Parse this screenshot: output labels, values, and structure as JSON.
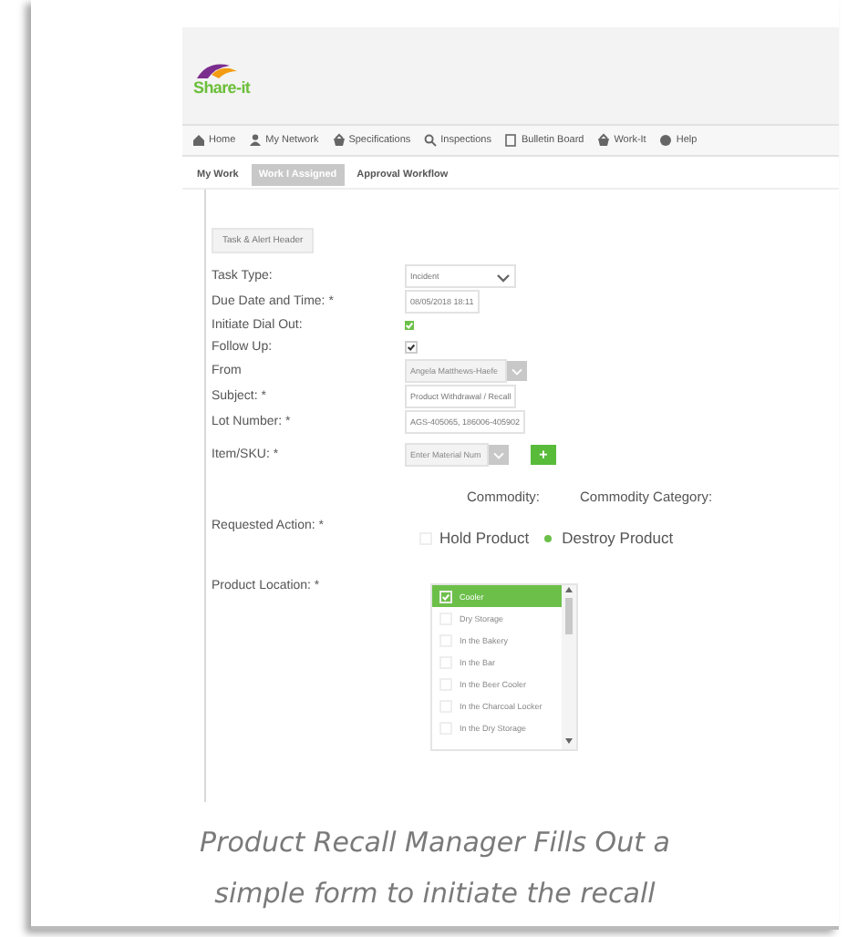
{
  "logo": {
    "text": "Share-it"
  },
  "nav": [
    {
      "label": "Home"
    },
    {
      "label": "My Network"
    },
    {
      "label": "Specifications"
    },
    {
      "label": "Inspections"
    },
    {
      "label": "Bulletin Board"
    },
    {
      "label": "Work-It"
    },
    {
      "label": "Help"
    }
  ],
  "tabs": [
    {
      "label": "My Work",
      "selected": false
    },
    {
      "label": "Work I Assigned",
      "selected": true
    },
    {
      "label": "Approval Workflow",
      "selected": false
    }
  ],
  "section": {
    "label": "Task & Alert Header"
  },
  "fields": [
    {
      "label": "Task Type:",
      "kind": "select",
      "value": "Incident"
    },
    {
      "label": "Due Date and Time: *",
      "kind": "text",
      "value": "08/05/2018 18:11"
    },
    {
      "label": "Initiate Dial Out:",
      "kind": "checkbox",
      "checked": true
    },
    {
      "label": "Follow Up:",
      "kind": "tickbox",
      "checked": true
    },
    {
      "label": "From",
      "kind": "lookup",
      "value": "Angela Matthews-Haefe"
    },
    {
      "label": "Subject: *",
      "kind": "text",
      "value": "Product Withdrawal / Recall"
    },
    {
      "label": "Lot Number: *",
      "kind": "text",
      "value": "AGS-405065, 186006-405902"
    },
    {
      "label": "Item/SKU: *",
      "kind": "lookup-add",
      "placeholder": "Enter Material Num",
      "add": "+"
    }
  ],
  "commodity": [
    "Commodity:",
    "Commodity Category:"
  ],
  "requested_action": {
    "label": "Requested Action: *",
    "options": [
      {
        "label": "Hold Product",
        "selected": false
      },
      {
        "label": "Destroy Product",
        "selected": true
      }
    ]
  },
  "product_location": {
    "label": "Product Location: *",
    "options": [
      {
        "label": "Cooler",
        "selected": true
      },
      {
        "label": "Dry Storage",
        "selected": false
      },
      {
        "label": "In the Bakery",
        "selected": false
      },
      {
        "label": "In the Bar",
        "selected": false
      },
      {
        "label": "In the Beer Cooler",
        "selected": false
      },
      {
        "label": "In the Charcoal Locker",
        "selected": false
      },
      {
        "label": "In the Dry Storage",
        "selected": false
      }
    ]
  },
  "caption": "Product Recall Manager Fills Out a simple form to initiate the recall"
}
